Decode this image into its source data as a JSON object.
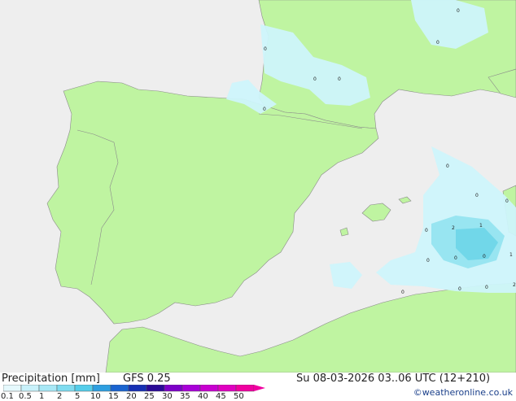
{
  "title": "Precipitation [mm]",
  "model": "GFS 0.25",
  "valid_time": "Su 08-03-2026 03..06 UTC (12+210)",
  "credit": "©weatheronline.co.uk",
  "colors": {
    "sea": "#eeeeee",
    "land": "#bff4a1",
    "border": "#8a8a8a",
    "precip_light": "#cdf4fb",
    "precip_medium": "#95e4f0",
    "precip_heavy": "#6fd6e8"
  },
  "legend": {
    "levels": [
      "0.1",
      "0.5",
      "1",
      "2",
      "5",
      "10",
      "15",
      "20",
      "25",
      "30",
      "35",
      "40",
      "45",
      "50"
    ],
    "colors": [
      "#e6f9fd",
      "#c8f1fa",
      "#a8e8f6",
      "#7fdcf0",
      "#54cdea",
      "#2e9fe0",
      "#1a64d0",
      "#1630b4",
      "#2a0a96",
      "#7c00c8",
      "#a800d8",
      "#c800d0",
      "#e000c0",
      "#f000a0"
    ]
  },
  "point_labels": [
    "0",
    "0",
    "0",
    "0",
    "0",
    "0",
    "0",
    "0",
    "0",
    "0",
    "2",
    "1",
    "0",
    "0",
    "0",
    "1",
    "0",
    "0",
    "2",
    "0",
    "1",
    "0"
  ]
}
